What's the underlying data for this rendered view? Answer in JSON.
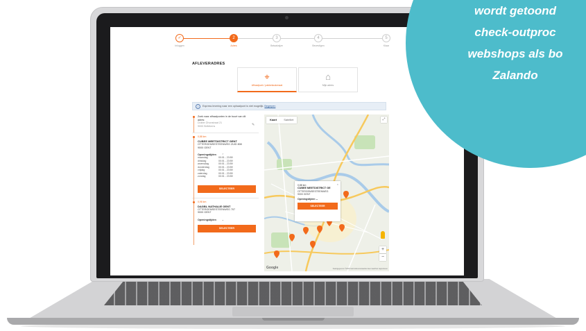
{
  "callout": {
    "lines": [
      "wordt getoond",
      "check-outproc",
      "webshops als bo",
      "Zalando"
    ]
  },
  "progress": {
    "steps": [
      {
        "label": "Inloggen",
        "state": "done",
        "glyph": "✓"
      },
      {
        "label": "Adres",
        "state": "active",
        "glyph": "2"
      },
      {
        "label": "Betaalwijze",
        "state": "todo",
        "glyph": "3"
      },
      {
        "label": "Bevestigen",
        "state": "todo",
        "glyph": "4"
      },
      {
        "label": "Klaar",
        "state": "todo",
        "glyph": "5"
      }
    ]
  },
  "delivery": {
    "title": "AFLEVERADRES",
    "options": [
      {
        "label": "Afhaalpunt / pakketautomaat",
        "icon": "location-pin-icon",
        "glyph": "⌖",
        "selected": true
      },
      {
        "label": "Mijn adres",
        "icon": "house-icon",
        "glyph": "⌂",
        "selected": false
      }
    ]
  },
  "info_bar": {
    "icon": "info-icon",
    "glyph": "i",
    "text": "Express levering naar een ophaalpunt is niet mogelijk.",
    "link": "Begrepen"
  },
  "search": {
    "prompt": "Zoek naar afhaalpunten in de buurt van dit adres:",
    "address_line1": "Dokter Dhonstraat 21",
    "address_line2": "9000 Bellekens",
    "edit_icon": "pencil-icon",
    "edit_glyph": "✎"
  },
  "locations": [
    {
      "distance": "0,88 km",
      "name": "CUBEE MEETDISTRICT GENT",
      "address_line1": "OTTERGEMSESTEENWEG ZUID 808",
      "address_line2": "9000 GENT",
      "hours_label": "Openingstijden",
      "hours": [
        {
          "day": "maandag",
          "time": "00:01 - 23:59"
        },
        {
          "day": "dinsdag",
          "time": "00:01 - 23:59"
        },
        {
          "day": "woensdag",
          "time": "00:01 - 23:59"
        },
        {
          "day": "donderdag",
          "time": "00:01 - 23:59"
        },
        {
          "day": "vrijdag",
          "time": "00:01 - 23:59"
        },
        {
          "day": "zaterdag",
          "time": "00:01 - 23:59"
        },
        {
          "day": "zondag",
          "time": "00:01 - 23:59"
        }
      ],
      "button": "SELECTEER"
    },
    {
      "distance": "0,98 km",
      "name": "DAGBL NATHALIE GENT",
      "address_line1": "OTTERGEMSESTEENWEG 707",
      "address_line2": "9000 GENT",
      "hours_label": "Openingstijden",
      "button": "SELECTEER"
    }
  ],
  "map": {
    "tabs": [
      "Kaart",
      "Satelliet"
    ],
    "fullscreen_glyph": "⤢",
    "zoom_in": "+",
    "zoom_out": "−",
    "logo": "Google",
    "footer": "Kaartgegevens ©2019   Gebruiksvoorwaarden   Een kaartfout rapporteren",
    "popup": {
      "distance": "0,88 km",
      "name": "CUBEE MEETDISTRICT GE",
      "address_line1": "OTTERGEMSESTEENWEG",
      "address_line2": "9000 GENT",
      "hours_label": "Openingstijden",
      "button": "SELECTEER",
      "close": "×"
    },
    "colors": {
      "land": "#eef0e8",
      "water": "#a9cbe9",
      "park": "#c8e3b8",
      "highway": "#f7c95c",
      "marker": "#f26a1b"
    }
  },
  "colors": {
    "accent": "#f26a1b",
    "callout": "#4dbccb"
  }
}
